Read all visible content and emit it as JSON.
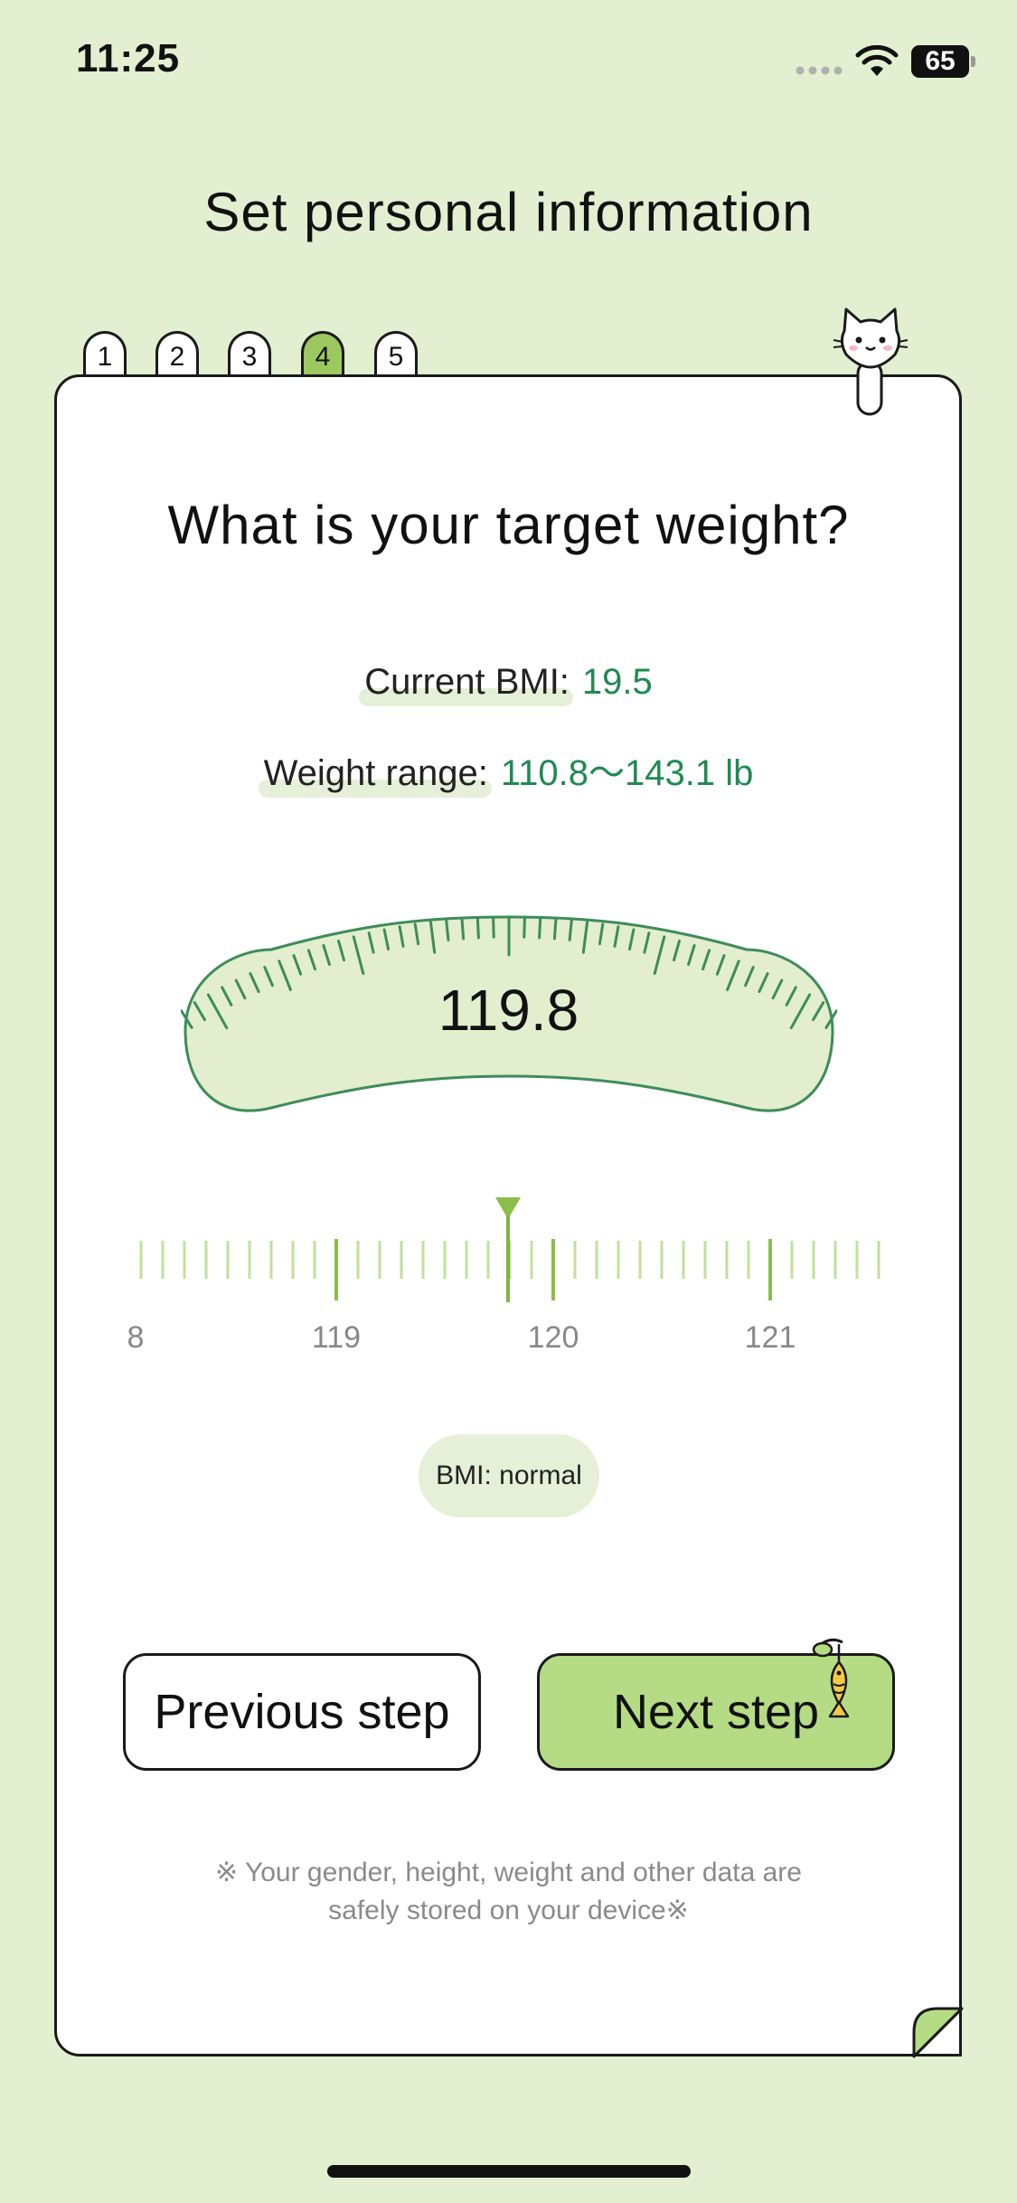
{
  "status_bar": {
    "time": "11:25",
    "battery": "65"
  },
  "header": {
    "title": "Set personal information"
  },
  "steps": [
    "1",
    "2",
    "3",
    "4",
    "5"
  ],
  "current_step": "4",
  "question": "What is your target weight?",
  "bmi_info": {
    "current_bmi_label": "Current BMI:",
    "current_bmi_value": "19.5",
    "weight_range_label": "Weight range:",
    "weight_range_value": "110.8～143.1 lb"
  },
  "dial": {
    "value": "119.8"
  },
  "ruler": {
    "labels": [
      "8",
      "119",
      "120",
      "121"
    ],
    "selected_value": 119.8
  },
  "bmi_badge": "BMI: normal",
  "buttons": {
    "previous": "Previous step",
    "next": "Next step"
  },
  "footnote": {
    "line1": "※ Your gender, height, weight and other data are",
    "line2": "safely stored on your device※"
  },
  "colors": {
    "background": "#e2efd0",
    "accent_green": "#9cc85f",
    "value_green": "#1f8a52",
    "dial_stroke": "#3e8c5a"
  }
}
